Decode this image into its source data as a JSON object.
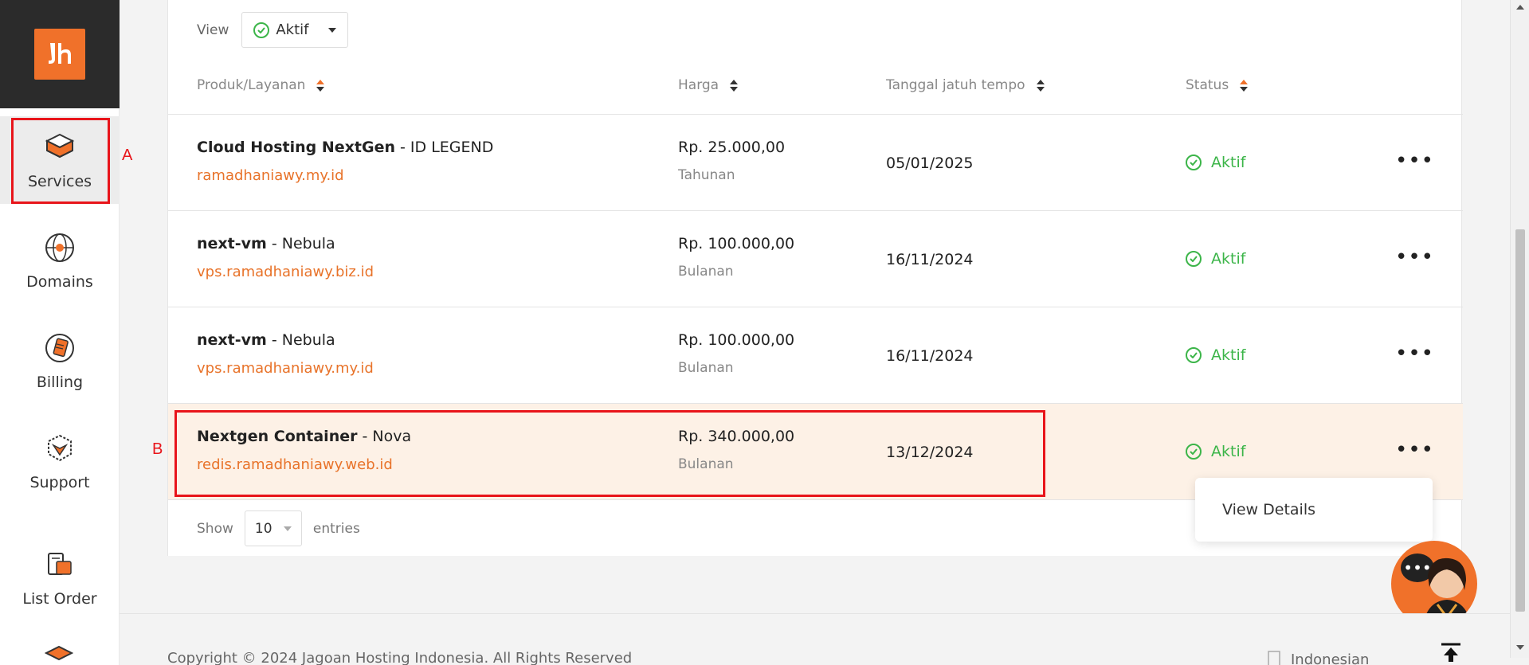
{
  "sidebar": {
    "logo_text": "Jh",
    "items": [
      {
        "label": "Services",
        "icon": "server-box-icon"
      },
      {
        "label": "Domains",
        "icon": "globe-icon"
      },
      {
        "label": "Billing",
        "icon": "billing-icon"
      },
      {
        "label": "Support",
        "icon": "support-icon"
      },
      {
        "label": "List Order",
        "icon": "order-icon"
      }
    ]
  },
  "annotations": {
    "a": "A",
    "b": "B"
  },
  "filter": {
    "view_label": "View",
    "view_value": "Aktif"
  },
  "table": {
    "columns": [
      "Produk/Layanan",
      "Harga",
      "Tanggal jatuh tempo",
      "Status"
    ],
    "rows": [
      {
        "name": "Cloud Hosting NextGen",
        "plan": " - ID LEGEND",
        "domain": "ramadhaniawy.my.id",
        "price": "Rp. 25.000,00",
        "cycle": "Tahunan",
        "due": "05/01/2025",
        "status": "Aktif"
      },
      {
        "name": "next-vm",
        "plan": " - Nebula",
        "domain": "vps.ramadhaniawy.biz.id",
        "price": "Rp. 100.000,00",
        "cycle": "Bulanan",
        "due": "16/11/2024",
        "status": "Aktif"
      },
      {
        "name": "next-vm",
        "plan": " - Nebula",
        "domain": "vps.ramadhaniawy.my.id",
        "price": "Rp. 100.000,00",
        "cycle": "Bulanan",
        "due": "16/11/2024",
        "status": "Aktif"
      },
      {
        "name": "Nextgen Container",
        "plan": " - Nova",
        "domain": "redis.ramadhaniawy.web.id",
        "price": "Rp. 340.000,00",
        "cycle": "Bulanan",
        "due": "13/12/2024",
        "status": "Aktif"
      }
    ],
    "more_glyph": "•••"
  },
  "pagination": {
    "show_label": "Show",
    "page_size": "10",
    "entries_label": "entries"
  },
  "dropdown": {
    "view_details": "View Details"
  },
  "chat": {
    "bubble": "•••"
  },
  "footer": {
    "copyright": "Copyright © 2024 Jagoan Hosting Indonesia. All Rights Reserved",
    "language": "Indonesian"
  },
  "colors": {
    "accent": "#f0712a",
    "status_green": "#3cb549",
    "annotation_red": "#e8141a",
    "highlight_row": "#fdf1e6"
  }
}
